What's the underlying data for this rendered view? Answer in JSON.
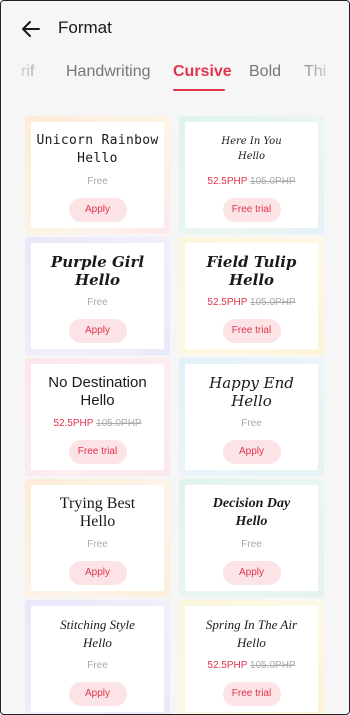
{
  "header": {
    "title": "Format"
  },
  "tabs": [
    {
      "label": "rif"
    },
    {
      "label": "Handwriting"
    },
    {
      "label": "Cursive"
    },
    {
      "label": "Bold"
    },
    {
      "label": "Thi"
    }
  ],
  "labels": {
    "free": "Free",
    "apply": "Apply",
    "free_trial": "Free trial"
  },
  "cards": [
    {
      "line1": "Unicorn Rainbow",
      "line2": "Hello",
      "free": true,
      "price": "",
      "orig": "",
      "button": "Apply"
    },
    {
      "line1": "Here In You",
      "line2": "Hello",
      "free": false,
      "price": "52.5PHP",
      "orig": "105.0PHP",
      "button": "Free trial"
    },
    {
      "line1": "Purple Girl",
      "line2": "Hello",
      "free": true,
      "price": "",
      "orig": "",
      "button": "Apply"
    },
    {
      "line1": "Field Tulip",
      "line2": "Hello",
      "free": false,
      "price": "52.5PHP",
      "orig": "105.0PHP",
      "button": "Free trial"
    },
    {
      "line1": "No Destination",
      "line2": "Hello",
      "free": false,
      "price": "52.5PHP",
      "orig": "105.0PHP",
      "button": "Free trial"
    },
    {
      "line1": "Happy End",
      "line2": "Hello",
      "free": true,
      "price": "",
      "orig": "",
      "button": "Apply"
    },
    {
      "line1": "Trying Best",
      "line2": "Hello",
      "free": true,
      "price": "",
      "orig": "",
      "button": "Apply"
    },
    {
      "line1": "Decision Day",
      "line2": "Hello",
      "free": true,
      "price": "",
      "orig": "",
      "button": "Apply"
    },
    {
      "line1": "Stitching Style",
      "line2": "Hello",
      "free": true,
      "price": "",
      "orig": "",
      "button": "Apply"
    },
    {
      "line1": "Spring In The Air",
      "line2": "Hello",
      "free": false,
      "price": "52.5PHP",
      "orig": "105.0PHP",
      "button": "Free trial"
    }
  ],
  "colors": {
    "accent": "#e2344c",
    "button_bg": "#fbe3e6",
    "background": "#f6f6f6"
  },
  "icons": {
    "back": "arrow-left-icon"
  }
}
